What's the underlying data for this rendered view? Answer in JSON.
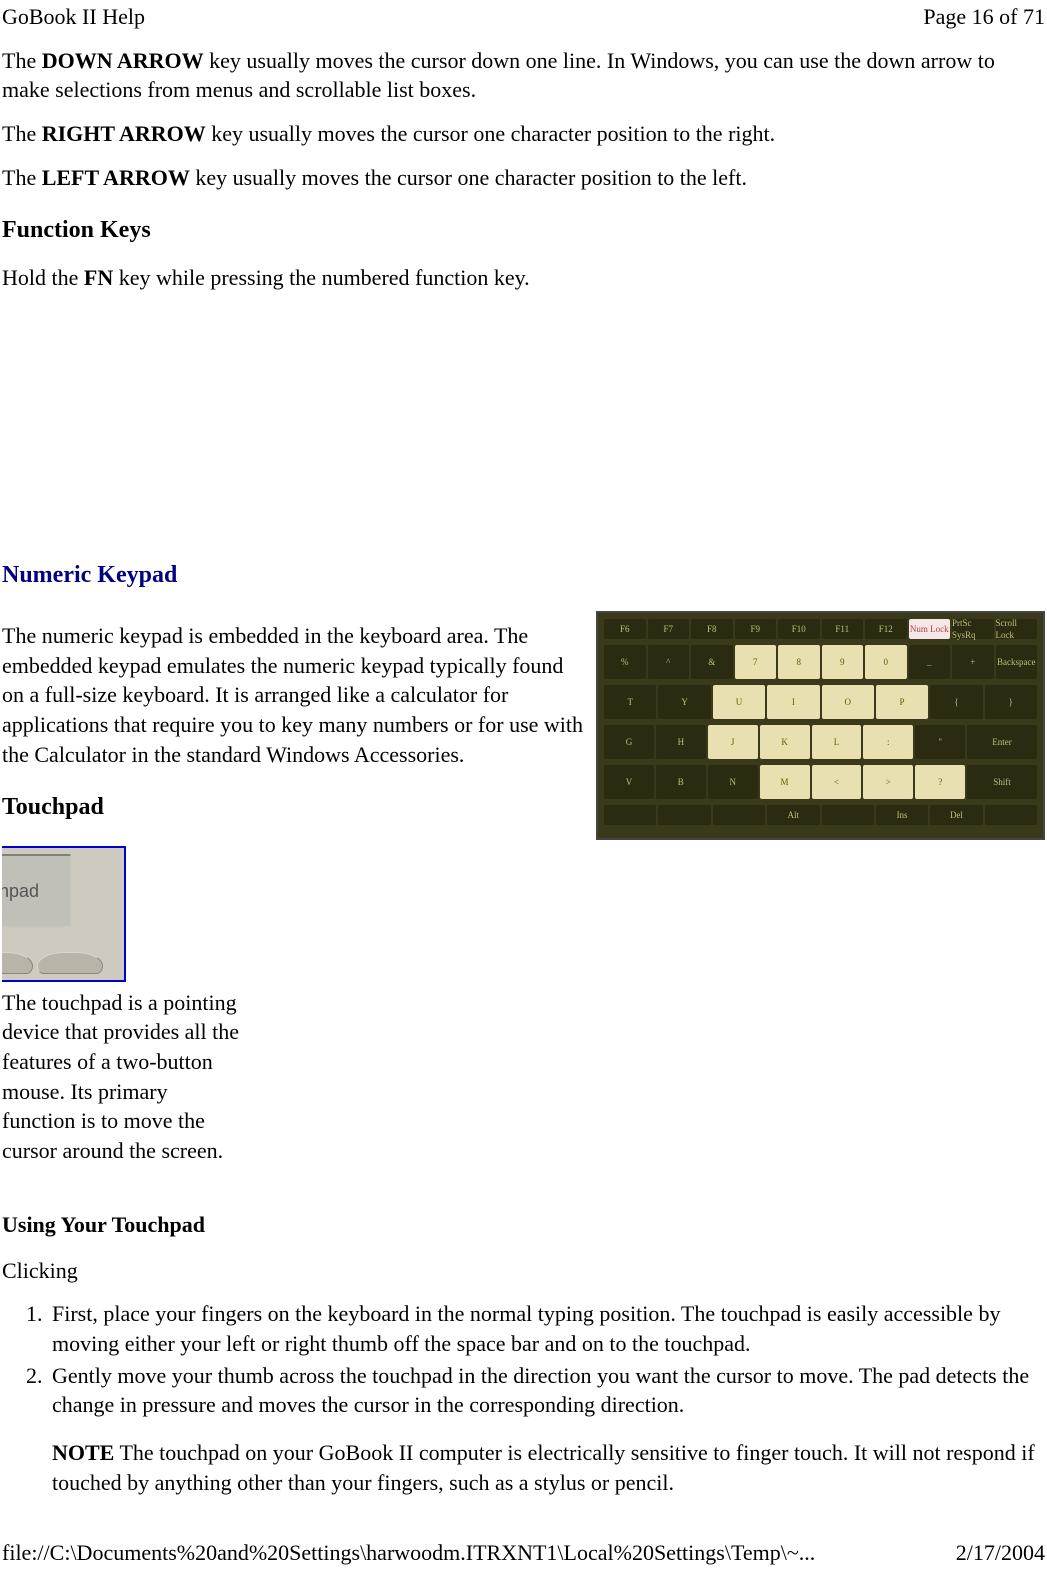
{
  "header": {
    "left": "GoBook II Help",
    "right": "Page 16 of 71"
  },
  "para_down_1": "The ",
  "down_bold": "DOWN ARROW",
  "para_down_2": " key usually moves the cursor down one line. In Windows, you can use the down arrow to make selections from menus and scrollable list boxes.",
  "para_right_1": "The ",
  "right_bold": "RIGHT ARROW",
  "para_right_2": " key usually moves the cursor one character position to the right.",
  "para_left_1": "The ",
  "left_bold": "LEFT ARROW",
  "para_left_2": " key usually moves the cursor one character position to the left.",
  "h_function": "Function Keys",
  "para_fn_1": "Hold the ",
  "fn_bold": "FN",
  "para_fn_2": " key while pressing the numbered function key.",
  "h_numeric": "Numeric Keypad",
  "para_numeric": "The numeric keypad is embedded in the keyboard area.  The embedded keypad emulates the numeric keypad typically found on a full-size keyboard.   It is arranged like a calculator for applications that require you to key many numbers or for use with the Calculator in the standard Windows Accessories.",
  "touchpad_label": "Touchpad",
  "h_touchpad": "Touchpad",
  "para_touchpad": "The touchpad  is a pointing device that provides all the features of a two-button mouse. Its primary function is to move the cursor around the screen.",
  "h_using": "Using Your Touchpad",
  "clicking": "Clicking",
  "li1": "First, place your fingers on the keyboard in the normal typing position. The touchpad is easily accessible by moving either your left or right thumb off the space bar and on to the touchpad.",
  "li2": "Gently move your thumb across the touchpad in the direction you want the cursor to move. The pad detects the change in pressure and moves the cursor in the corresponding direction.",
  "note_bold": "NOTE",
  "note_rest": "  The touchpad on your GoBook II computer is electrically sensitive to finger touch.  It will not respond if touched by anything other than your fingers, such as a stylus or pencil.",
  "footer": {
    "left": "file://C:\\Documents%20and%20Settings\\harwoodm.ITRXNT1\\Local%20Settings\\Temp\\~...",
    "right": "2/17/2004"
  },
  "keys": {
    "r0": [
      "F6",
      "F7",
      "F8",
      "F9",
      "F10",
      "F11",
      "F12",
      "Num Lock",
      "PrtSc SysRq",
      "Scroll Lock"
    ],
    "r1": [
      "%",
      "^",
      "&",
      "7",
      "8",
      "9",
      "0",
      "_",
      "+",
      "Backspace"
    ],
    "r2": [
      "T",
      "Y",
      "U",
      "I",
      "O",
      "P",
      "{",
      "}"
    ],
    "r3": [
      "G",
      "H",
      "J",
      "K",
      "L",
      ":",
      "\"",
      "Enter"
    ],
    "r4": [
      "V",
      "B",
      "N",
      "M",
      "<",
      ">",
      "?",
      "Shift"
    ],
    "r5": [
      "",
      "",
      "",
      "Alt",
      "",
      "Ins",
      "Del",
      ""
    ]
  }
}
